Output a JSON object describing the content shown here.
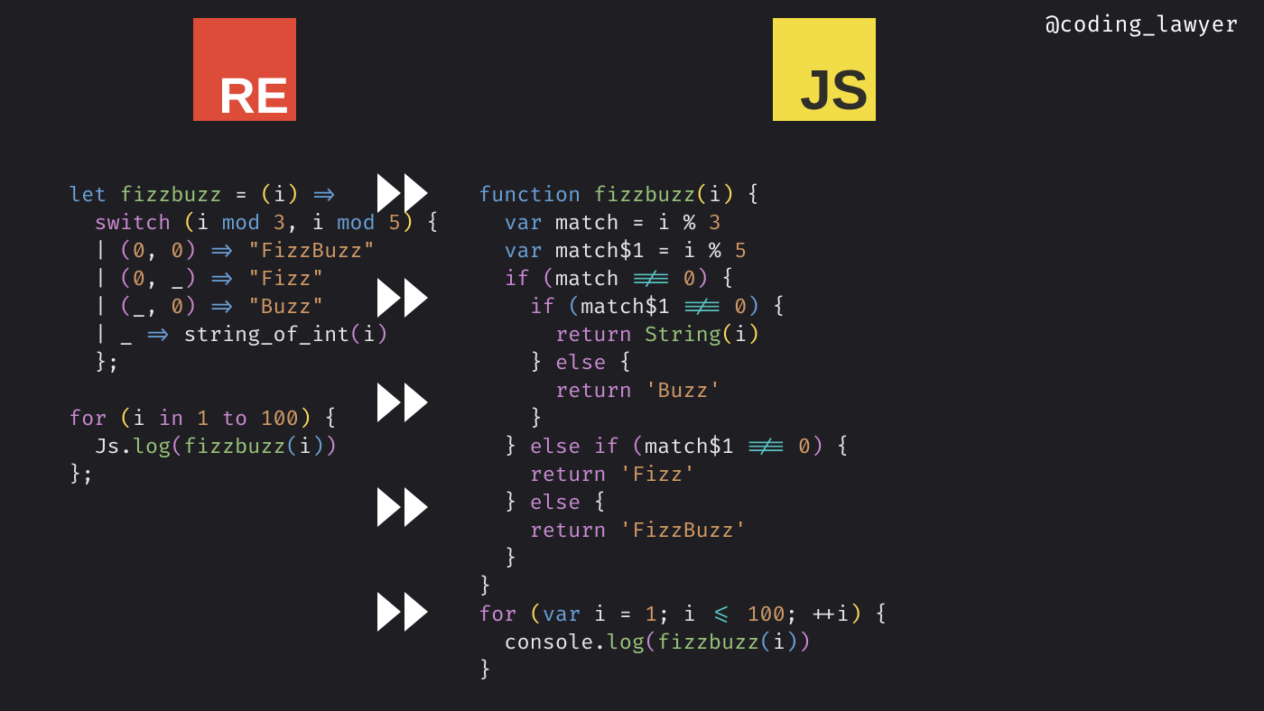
{
  "handle": "@coding_lawyer",
  "logos": {
    "left": "RE",
    "right": "JS"
  },
  "code": {
    "left": {
      "l1": {
        "a": "let ",
        "b": "fizzbuzz",
        "c": " = ",
        "d": "(",
        "e": "i",
        "f": ")",
        "g": " =>"
      },
      "l2": {
        "a": "  ",
        "b": "switch ",
        "c": "(",
        "d": "i ",
        "e": "mod ",
        "f": "3",
        "g": ", i ",
        "h": "mod ",
        "i": "5",
        "j": ")",
        "k": " {"
      },
      "l3": {
        "a": "  ",
        "b": "| ",
        "c": "(",
        "d": "0",
        "e": ", ",
        "f": "0",
        "g": ")",
        "h": " => ",
        "i": "\"FizzBuzz\""
      },
      "l4": {
        "a": "  ",
        "b": "| ",
        "c": "(",
        "d": "0",
        "e": ", ",
        "f": "_",
        "g": ")",
        "h": " => ",
        "i": "\"Fizz\""
      },
      "l5": {
        "a": "  ",
        "b": "| ",
        "c": "(",
        "d": "_",
        "e": ", ",
        "f": "0",
        "g": ")",
        "h": " => ",
        "i": "\"Buzz\""
      },
      "l6": {
        "a": "  ",
        "b": "| ",
        "c": "_",
        "d": " => ",
        "e": "string_of_int",
        "f": "(",
        "g": "i",
        "h": ")"
      },
      "l7": {
        "a": "  };"
      },
      "blank": "",
      "l8": {
        "a": "for ",
        "b": "(",
        "c": "i ",
        "d": "in ",
        "e": "1",
        "f": " to ",
        "g": "100",
        "h": ")",
        "i": " {"
      },
      "l9": {
        "a": "  Js.",
        "b": "log",
        "c": "(",
        "d": "fizzbuzz",
        "e": "(",
        "f": "i",
        "g": ")",
        "h": ")"
      },
      "l10": {
        "a": "};"
      }
    },
    "right": {
      "l1": {
        "a": "function ",
        "b": "fizzbuzz",
        "c": "(",
        "d": "i",
        "e": ")",
        "f": " {"
      },
      "l2": {
        "a": "  ",
        "b": "var ",
        "c": "match ",
        "d": "=",
        "e": " i ",
        "f": "%",
        "g": " ",
        "h": "3"
      },
      "l3": {
        "a": "  ",
        "b": "var ",
        "c": "match$1 ",
        "d": "=",
        "e": " i ",
        "f": "%",
        "g": " ",
        "h": "5"
      },
      "l4": {
        "a": "  ",
        "b": "if ",
        "c": "(",
        "d": "match ",
        "e": "!==",
        "f": " ",
        "g": "0",
        "h": ")",
        "i": " {"
      },
      "l5": {
        "a": "    ",
        "b": "if ",
        "c": "(",
        "d": "match$1 ",
        "e": "!==",
        "f": " ",
        "g": "0",
        "h": ")",
        "i": " {"
      },
      "l6": {
        "a": "      ",
        "b": "return ",
        "c": "String",
        "d": "(",
        "e": "i",
        "f": ")"
      },
      "l7": {
        "a": "    } ",
        "b": "else",
        "c": " {"
      },
      "l8": {
        "a": "      ",
        "b": "return ",
        "c": "'Buzz'"
      },
      "l9": {
        "a": "    }"
      },
      "l10": {
        "a": "  } ",
        "b": "else if ",
        "c": "(",
        "d": "match$1 ",
        "e": "!==",
        "f": " ",
        "g": "0",
        "h": ")",
        "i": " {"
      },
      "l11": {
        "a": "    ",
        "b": "return ",
        "c": "'Fizz'"
      },
      "l12": {
        "a": "  } ",
        "b": "else",
        "c": " {"
      },
      "l13": {
        "a": "    ",
        "b": "return ",
        "c": "'FizzBuzz'"
      },
      "l14": {
        "a": "  }"
      },
      "l15": {
        "a": "}"
      },
      "l16": {
        "a": "for ",
        "b": "(",
        "c": "var ",
        "d": "i ",
        "e": "=",
        "f": " ",
        "g": "1",
        "h": "; i ",
        "i": "<=",
        "j": " ",
        "k": "100",
        "l": "; ",
        "m": "++",
        "n": "i",
        "o": ")",
        "p": " {"
      },
      "l17": {
        "a": "  console.",
        "b": "log",
        "c": "(",
        "d": "fizzbuzz",
        "e": "(",
        "f": "i",
        "g": ")",
        "h": ")"
      },
      "l18": {
        "a": "}"
      }
    }
  }
}
